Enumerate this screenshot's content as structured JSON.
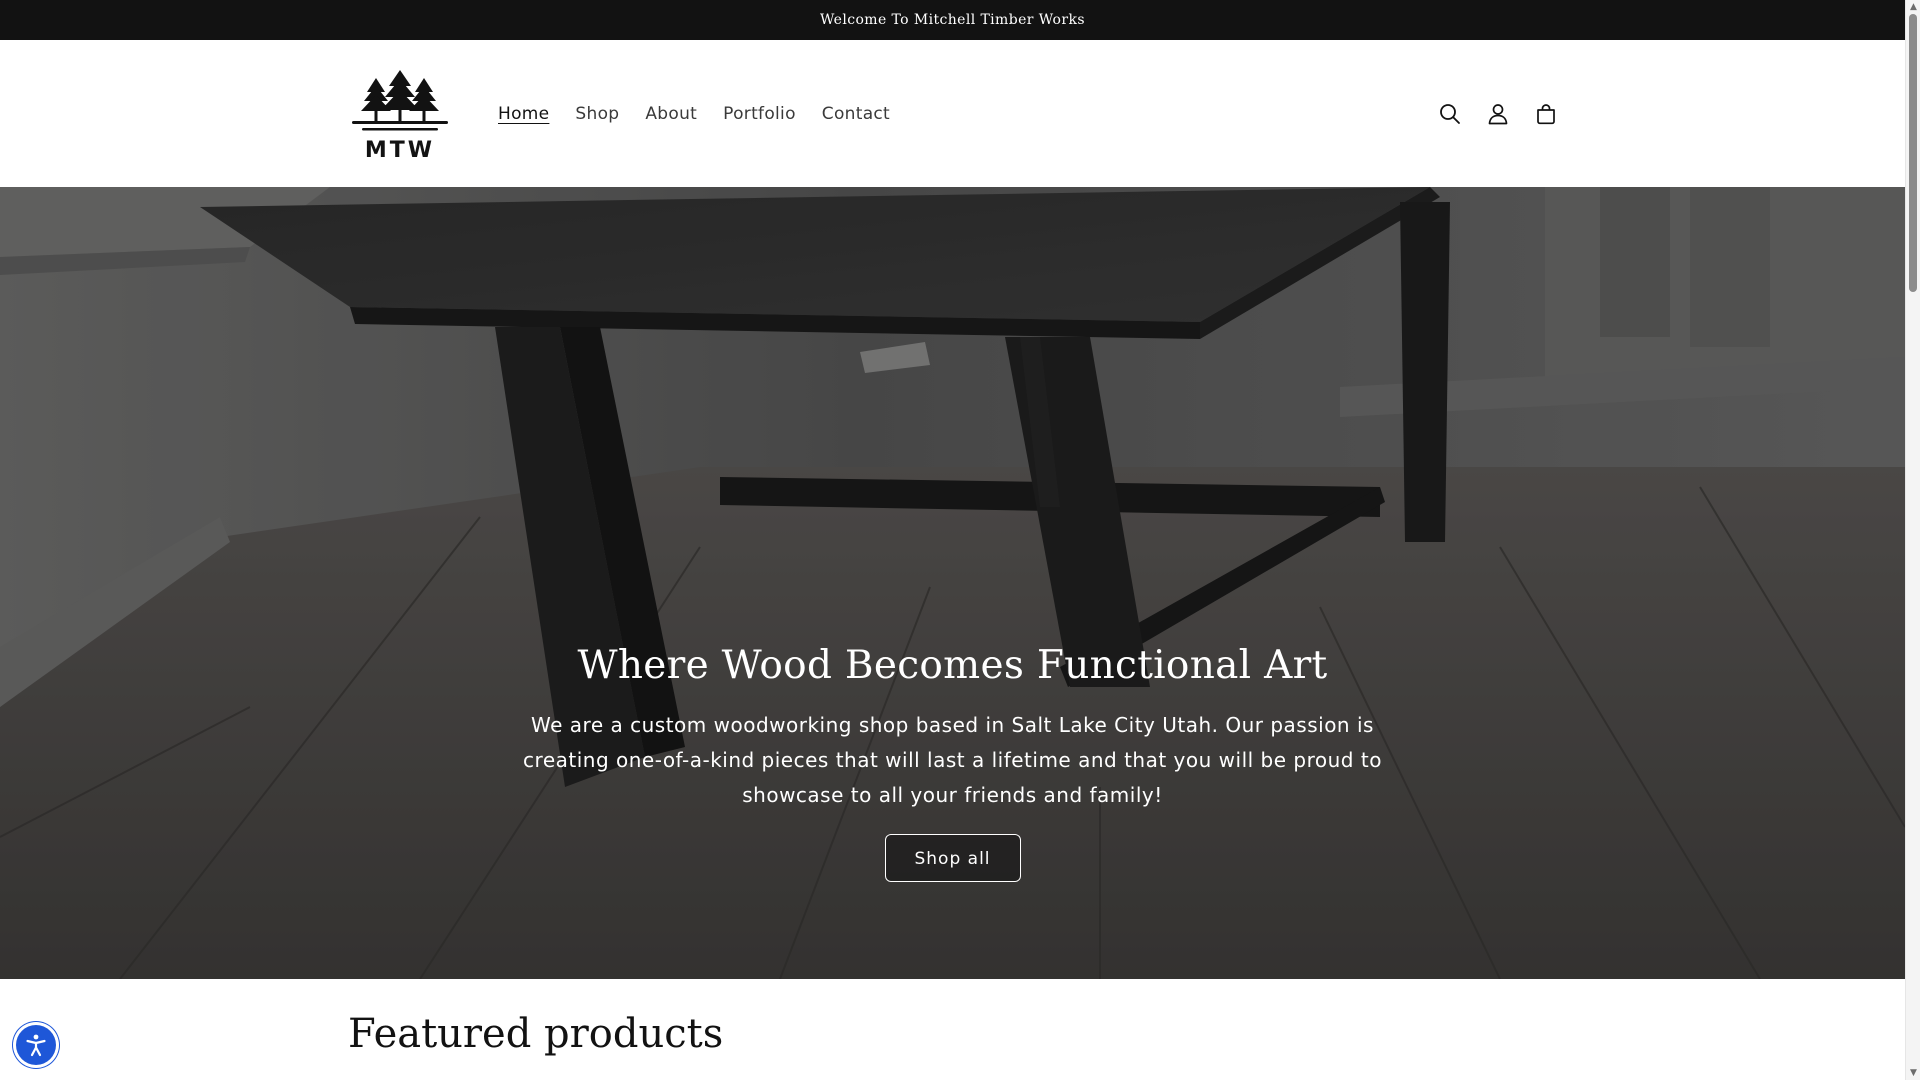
{
  "announcement": {
    "text": "Welcome To Mitchell Timber Works"
  },
  "header": {
    "logo_text": "MTW",
    "nav": [
      {
        "label": "Home",
        "active": true
      },
      {
        "label": "Shop"
      },
      {
        "label": "About"
      },
      {
        "label": "Portfolio"
      },
      {
        "label": "Contact"
      }
    ],
    "icons": [
      "search-icon",
      "account-icon",
      "cart-icon"
    ]
  },
  "hero": {
    "title": "Where Wood Becomes Functional Art",
    "text": "We are a custom woodworking shop based in Salt Lake City Utah. Our passion is creating one-of-a-kind pieces that will last a lifetime and that you will be proud to showcase to all your friends and family!",
    "button_label": "Shop all"
  },
  "featured": {
    "title": "Featured products"
  },
  "accessibility": {
    "icon": "accessibility-icon",
    "color": "#1e57d8"
  },
  "colors": {
    "bar": "#121212",
    "text": "#121212",
    "accent": "#1e57d8"
  }
}
